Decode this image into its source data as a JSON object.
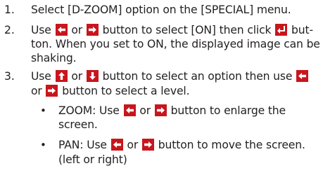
{
  "steps": [
    {
      "number": "1.",
      "line1": "Select [D-ZOOM] option on the [SPECIAL] menu."
    },
    {
      "number": "2.",
      "line1_a": "Use",
      "line1_b": "or",
      "line1_c": "button to select [ON] then click",
      "line1_d": "but-",
      "line2": "ton. When you set to ON, the displayed image can be",
      "line3": "shaking."
    },
    {
      "number": "3.",
      "line1_a": "Use",
      "line1_b": "or",
      "line1_c": "button to select an option then use",
      "line2_a": "or",
      "line2_b": "button to select a level."
    }
  ],
  "sub_items": [
    {
      "line1_a": "ZOOM: Use",
      "line1_b": "or",
      "line1_c": "button to enlarge the",
      "line2": "screen."
    },
    {
      "line1_a": "PAN: Use",
      "line1_b": "or",
      "line1_c": "button to move the screen.",
      "line2": "(left or right)"
    }
  ],
  "icons": {
    "left": "left-arrow-key-icon",
    "right": "right-arrow-key-icon",
    "up": "up-arrow-key-icon",
    "down": "down-arrow-key-icon",
    "enter": "enter-key-icon",
    "key_color": "#c8161d"
  }
}
